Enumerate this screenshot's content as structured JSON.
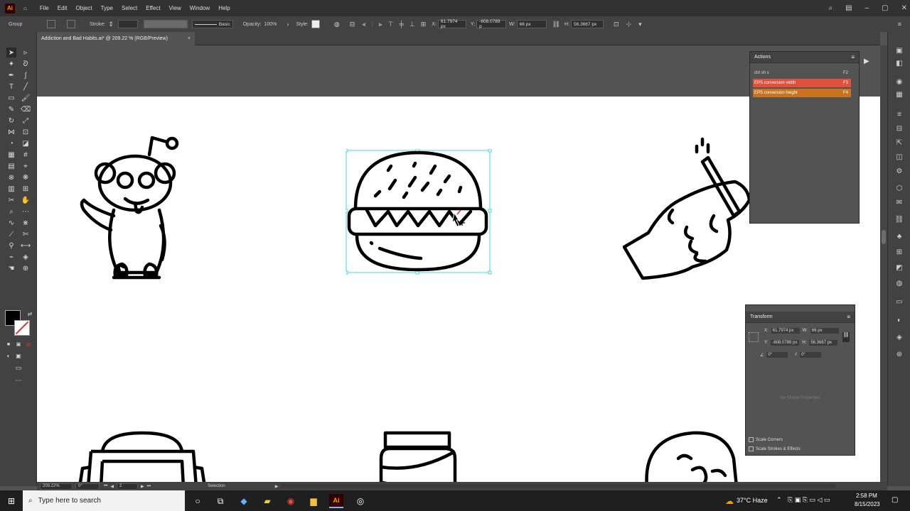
{
  "menubar": {
    "app_icon": "Ai",
    "home_icon": "home-icon",
    "items": [
      "File",
      "Edit",
      "Object",
      "Type",
      "Select",
      "Effect",
      "View",
      "Window",
      "Help"
    ]
  },
  "control": {
    "selection_label": "Group",
    "stroke_label": "Stroke:",
    "stroke_style": "Basic",
    "opacity_label": "Opacity:",
    "opacity_value": "100%",
    "style_label": "Style:",
    "x_label": "X:",
    "x_value": "61.7974 px",
    "y_label": "Y:",
    "y_value": "-608.0789 p",
    "w_label": "W:",
    "w_value": "66 px",
    "h_label": "H:",
    "h_value": "56.3667 px"
  },
  "document": {
    "tab_title": "Addiction and Bad Habits.ai* @ 209.22 % (RGB/Preview)",
    "close": "×"
  },
  "actions_panel": {
    "title": "Actions",
    "rows": [
      {
        "label": "ctrl sh s",
        "key": "F2",
        "color": "#535353"
      },
      {
        "label": "EPS conversion width",
        "key": "F3",
        "color": "#e0503c"
      },
      {
        "label": "EPS conversion height",
        "key": "F4",
        "color": "#c8741e"
      }
    ]
  },
  "transform_panel": {
    "title": "Transform",
    "x_label": "X:",
    "x_value": "61.7974 px",
    "y_label": "Y:",
    "y_value": "-608.0789 px",
    "w_label": "W:",
    "w_value": "66 px",
    "h_label": "H:",
    "h_value": "56.3667 px",
    "angle_value": "0°",
    "shear_value": "0°",
    "no_shape": "No Shape Properties",
    "scale_corners": "Scale Corners",
    "scale_strokes": "Scale Strokes & Effects"
  },
  "status": {
    "zoom": "209.22%",
    "rotation": "0°",
    "artboard": "2",
    "tool": "Selection"
  },
  "taskbar": {
    "search_placeholder": "Type here to search",
    "weather": "37°C Haze",
    "time": "2:58 PM",
    "date": "8/15/2023"
  }
}
